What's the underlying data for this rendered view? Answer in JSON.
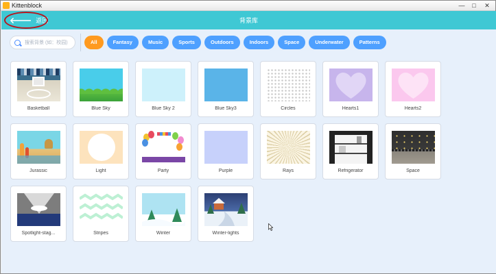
{
  "window": {
    "title": "Kittenblock",
    "min_glyph": "—",
    "max_glyph": "□",
    "close_glyph": "✕"
  },
  "topbar": {
    "back_label": "返回",
    "back_arrow": "🡐",
    "page_title": "背景库"
  },
  "search": {
    "placeholder": "搜索背景 (如：校园)"
  },
  "tags": [
    "All",
    "Fantasy",
    "Music",
    "Sports",
    "Outdoors",
    "Indoors",
    "Space",
    "Underwater",
    "Patterns"
  ],
  "active_tag": "All",
  "backdrops": [
    "Basketball",
    "Blue Sky",
    "Blue Sky 2",
    "Blue Sky3",
    "Circles",
    "Hearts1",
    "Hearts2",
    "Jurassic",
    "Light",
    "Party",
    "Purple",
    "Rays",
    "Refrigerator",
    "Space",
    "Spotlight-stag...",
    "Stripes",
    "Winter",
    "Winter-lights"
  ],
  "colors": {
    "topbar": "#3fc8d4",
    "tag": "#4ea0ff",
    "active_tag": "#ff9a1f",
    "content_bg": "#e7f0fb",
    "annotation": "#b8141d"
  }
}
